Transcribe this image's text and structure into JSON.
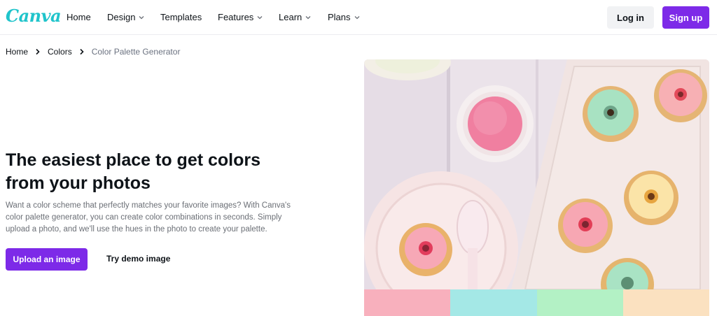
{
  "brand": {
    "logo_text": "Canva"
  },
  "nav": {
    "items": [
      {
        "label": "Home",
        "has_dropdown": false
      },
      {
        "label": "Design",
        "has_dropdown": true
      },
      {
        "label": "Templates",
        "has_dropdown": false
      },
      {
        "label": "Features",
        "has_dropdown": true
      },
      {
        "label": "Learn",
        "has_dropdown": true
      },
      {
        "label": "Plans",
        "has_dropdown": true
      }
    ],
    "login_label": "Log in",
    "signup_label": "Sign up"
  },
  "breadcrumb": {
    "items": [
      "Home",
      "Colors",
      "Color Palette Generator"
    ]
  },
  "hero": {
    "title": "The easiest place to get colors from your photos",
    "description": "Want a color scheme that perfectly matches your favorite images? With Canva's color palette generator, you can create color combinations in seconds. Simply upload a photo, and we'll use the hues in the photo to create your palette.",
    "upload_label": "Upload an image",
    "demo_label": "Try demo image"
  },
  "palette": {
    "colors": [
      "#f8b0bd",
      "#a4e8e6",
      "#b3f1c5",
      "#fbe1c0"
    ]
  },
  "colors": {
    "accent": "#7d2ae8",
    "logo": "#20c4cb"
  }
}
